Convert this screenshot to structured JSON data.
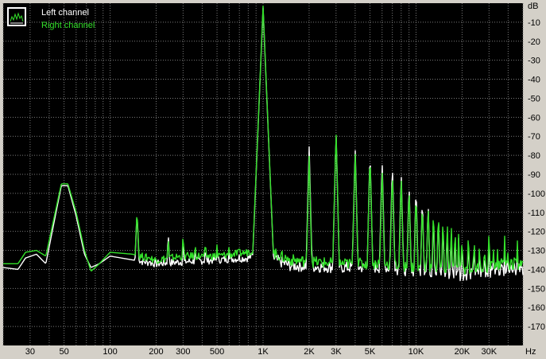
{
  "chart_data": {
    "type": "line",
    "xscale": "log",
    "xlim": [
      20,
      50000
    ],
    "ylim": [
      -180,
      0
    ],
    "grid": true,
    "legend_position": "top-left",
    "y_unit": "dB",
    "x_unit": "Hz",
    "y_ticks": [
      "-10",
      "-20",
      "-30",
      "-40",
      "-50",
      "-60",
      "-70",
      "-80",
      "-90",
      "-100",
      "-110",
      "-120",
      "-130",
      "-140",
      "-150",
      "-160",
      "-170"
    ],
    "x_ticks": [
      {
        "value": 30,
        "label": "30"
      },
      {
        "value": 50,
        "label": "50"
      },
      {
        "value": 100,
        "label": "100"
      },
      {
        "value": 200,
        "label": "200"
      },
      {
        "value": 300,
        "label": "300"
      },
      {
        "value": 500,
        "label": "500"
      },
      {
        "value": 1000,
        "label": "1K"
      },
      {
        "value": 2000,
        "label": "2K"
      },
      {
        "value": 3000,
        "label": "3K"
      },
      {
        "value": 5000,
        "label": "5K"
      },
      {
        "value": 10000,
        "label": "10K"
      },
      {
        "value": 20000,
        "label": "20K"
      },
      {
        "value": 30000,
        "label": "30K"
      }
    ],
    "series": [
      {
        "name": "Left channel",
        "color": "#ffffff",
        "floor": [
          [
            20,
            -139
          ],
          [
            25,
            -140
          ],
          [
            28,
            -134
          ],
          [
            33,
            -132
          ],
          [
            38,
            -137
          ],
          [
            48,
            -96
          ],
          [
            53,
            -96
          ],
          [
            60,
            -112
          ],
          [
            68,
            -132
          ],
          [
            75,
            -139
          ],
          [
            85,
            -137
          ],
          [
            100,
            -133
          ],
          [
            140,
            -135
          ],
          [
            200,
            -137
          ],
          [
            300,
            -136
          ],
          [
            500,
            -135
          ],
          [
            800,
            -134
          ],
          [
            950,
            -131
          ],
          [
            1050,
            -133
          ],
          [
            1500,
            -138
          ],
          [
            3000,
            -139
          ],
          [
            6000,
            -139
          ],
          [
            10000,
            -141
          ],
          [
            20000,
            -143
          ],
          [
            40000,
            -140
          ],
          [
            50000,
            -140
          ]
        ],
        "peaks": [
          [
            60,
            -131
          ],
          [
            110,
            -133
          ],
          [
            150,
            -110
          ],
          [
            180,
            -133
          ],
          [
            240,
            -121
          ],
          [
            300,
            -125
          ],
          [
            360,
            -128
          ],
          [
            420,
            -127
          ],
          [
            500,
            -130
          ],
          [
            600,
            -129
          ],
          [
            700,
            -131
          ],
          [
            800,
            -130
          ],
          [
            1000,
            -3
          ],
          [
            2000,
            -75
          ],
          [
            3000,
            -68
          ],
          [
            4000,
            -76
          ],
          [
            5000,
            -78
          ],
          [
            6000,
            -82
          ],
          [
            7000,
            -84
          ],
          [
            8000,
            -89
          ],
          [
            9000,
            -94
          ],
          [
            10000,
            -96
          ],
          [
            11000,
            -102
          ],
          [
            12000,
            -104
          ],
          [
            13000,
            -111
          ],
          [
            14000,
            -110
          ],
          [
            15000,
            -115
          ],
          [
            16000,
            -118
          ],
          [
            17000,
            -119
          ],
          [
            18000,
            -120
          ],
          [
            19000,
            -122
          ],
          [
            20000,
            -123
          ],
          [
            22000,
            -124
          ],
          [
            24000,
            -125
          ],
          [
            26000,
            -126
          ],
          [
            28000,
            -128
          ],
          [
            30000,
            -124
          ],
          [
            32000,
            -128
          ],
          [
            34000,
            -129
          ],
          [
            36000,
            -130
          ],
          [
            38000,
            -128
          ],
          [
            40000,
            -130
          ],
          [
            42000,
            -131
          ],
          [
            44000,
            -132
          ],
          [
            46000,
            -130
          ]
        ]
      },
      {
        "name": "Right channel",
        "color": "#33e02a",
        "floor": [
          [
            20,
            -137
          ],
          [
            25,
            -137
          ],
          [
            28,
            -131
          ],
          [
            33,
            -130
          ],
          [
            38,
            -133
          ],
          [
            48,
            -95
          ],
          [
            53,
            -95
          ],
          [
            60,
            -110
          ],
          [
            68,
            -130
          ],
          [
            75,
            -141
          ],
          [
            85,
            -137
          ],
          [
            100,
            -131
          ],
          [
            140,
            -132
          ],
          [
            200,
            -135
          ],
          [
            300,
            -133
          ],
          [
            500,
            -133
          ],
          [
            800,
            -131
          ],
          [
            950,
            -128
          ],
          [
            1050,
            -130
          ],
          [
            1500,
            -135
          ],
          [
            3000,
            -137
          ],
          [
            6000,
            -137
          ],
          [
            10000,
            -139
          ],
          [
            20000,
            -140
          ],
          [
            40000,
            -138
          ],
          [
            50000,
            -137
          ]
        ],
        "peaks": [
          [
            60,
            -129
          ],
          [
            110,
            -130
          ],
          [
            150,
            -109
          ],
          [
            180,
            -131
          ],
          [
            240,
            -123
          ],
          [
            300,
            -121
          ],
          [
            360,
            -125
          ],
          [
            420,
            -124
          ],
          [
            500,
            -127
          ],
          [
            600,
            -126
          ],
          [
            700,
            -128
          ],
          [
            800,
            -127
          ],
          [
            1000,
            -2
          ],
          [
            2000,
            -80
          ],
          [
            3000,
            -67
          ],
          [
            4000,
            -78
          ],
          [
            5000,
            -79
          ],
          [
            6000,
            -86
          ],
          [
            7000,
            -88
          ],
          [
            8000,
            -91
          ],
          [
            9000,
            -96
          ],
          [
            10000,
            -99
          ],
          [
            11000,
            -104
          ],
          [
            12000,
            -105
          ],
          [
            13000,
            -108
          ],
          [
            14000,
            -109
          ],
          [
            15000,
            -112
          ],
          [
            16000,
            -114
          ],
          [
            17000,
            -116
          ],
          [
            18000,
            -117
          ],
          [
            19000,
            -120
          ],
          [
            20000,
            -121
          ],
          [
            22000,
            -119
          ],
          [
            24000,
            -122
          ],
          [
            26000,
            -124
          ],
          [
            28000,
            -125
          ],
          [
            30000,
            -118
          ],
          [
            32000,
            -125
          ],
          [
            34000,
            -126
          ],
          [
            36000,
            -127
          ],
          [
            38000,
            -122
          ],
          [
            40000,
            -126
          ],
          [
            42000,
            -128
          ],
          [
            44000,
            -129
          ],
          [
            46000,
            -125
          ]
        ]
      }
    ]
  }
}
